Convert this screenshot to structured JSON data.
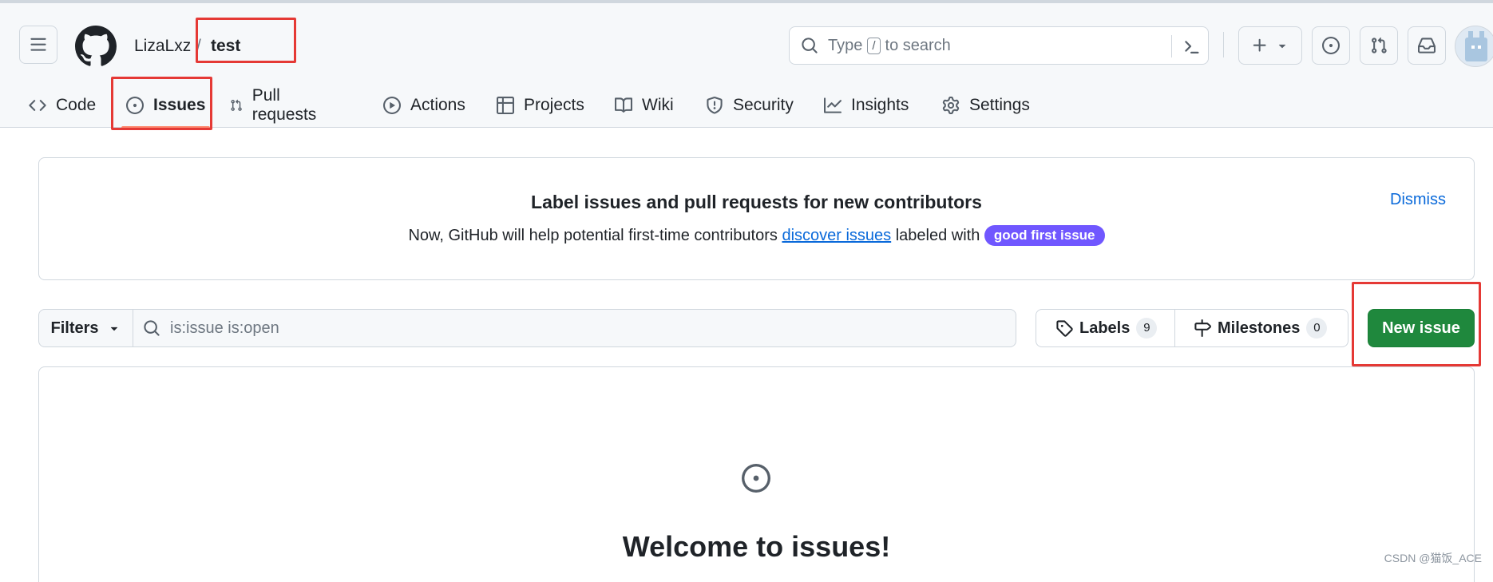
{
  "header": {
    "owner": "LizaLxz",
    "separator": "/",
    "repo": "test",
    "search": {
      "prefix": "Type",
      "key": "/",
      "suffix": "to search"
    }
  },
  "tabs": [
    {
      "label": "Code",
      "icon": "code-icon"
    },
    {
      "label": "Issues",
      "icon": "issue-opened-icon",
      "active": true
    },
    {
      "label": "Pull requests",
      "icon": "git-pull-request-icon"
    },
    {
      "label": "Actions",
      "icon": "play-icon"
    },
    {
      "label": "Projects",
      "icon": "table-icon"
    },
    {
      "label": "Wiki",
      "icon": "book-icon"
    },
    {
      "label": "Security",
      "icon": "shield-icon"
    },
    {
      "label": "Insights",
      "icon": "graph-icon"
    },
    {
      "label": "Settings",
      "icon": "gear-icon"
    }
  ],
  "banner": {
    "title": "Label issues and pull requests for new contributors",
    "text_before": "Now, GitHub will help potential first-time contributors",
    "link": "discover issues",
    "text_after": "labeled with",
    "label_pill": "good first issue",
    "dismiss": "Dismiss"
  },
  "toolbar": {
    "filters_label": "Filters",
    "filter_value": "is:issue is:open",
    "labels_label": "Labels",
    "labels_count": "9",
    "milestones_label": "Milestones",
    "milestones_count": "0",
    "new_issue_label": "New issue"
  },
  "blankslate": {
    "title": "Welcome to issues!"
  },
  "watermark": "CSDN @猫饭_ACE",
  "colors": {
    "primary_button": "#1f883d",
    "link": "#0969da",
    "active_tab_underline": "#fd8c73",
    "good_first_issue": "#7057ff",
    "highlight_box": "#e53935"
  }
}
